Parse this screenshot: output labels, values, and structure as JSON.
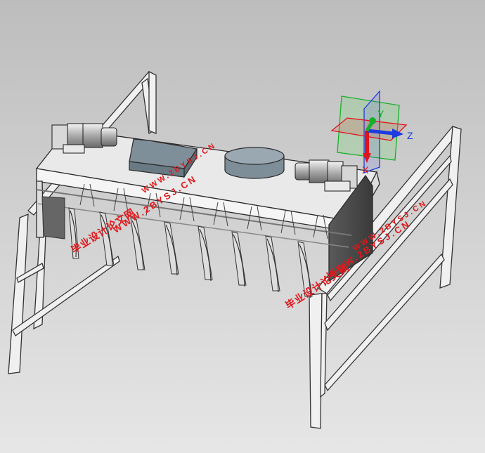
{
  "viewport": {
    "background_top": "#bdbdbd",
    "background_bottom": "#e6e6e6",
    "model": "frame-mounted machine with gearmotors and 8 hanging comb blades"
  },
  "triad": {
    "x_label": "X",
    "y_label": "Y",
    "z_label": "Z",
    "x_color": "#e0141c",
    "y_color": "#16b028",
    "z_color": "#1c3ce0"
  },
  "watermarks": {
    "left_cn": "毕业设计论文网",
    "left_url": "WWW.2BYSJ.CN",
    "top_url": "WWW.2BYSJ.CN",
    "right_cn": "毕业设计论文网",
    "right_url": "WWW.2BYSJ.CN",
    "far_right_url": "WWW.2BYSJ.CN",
    "color": "#e0181c"
  }
}
